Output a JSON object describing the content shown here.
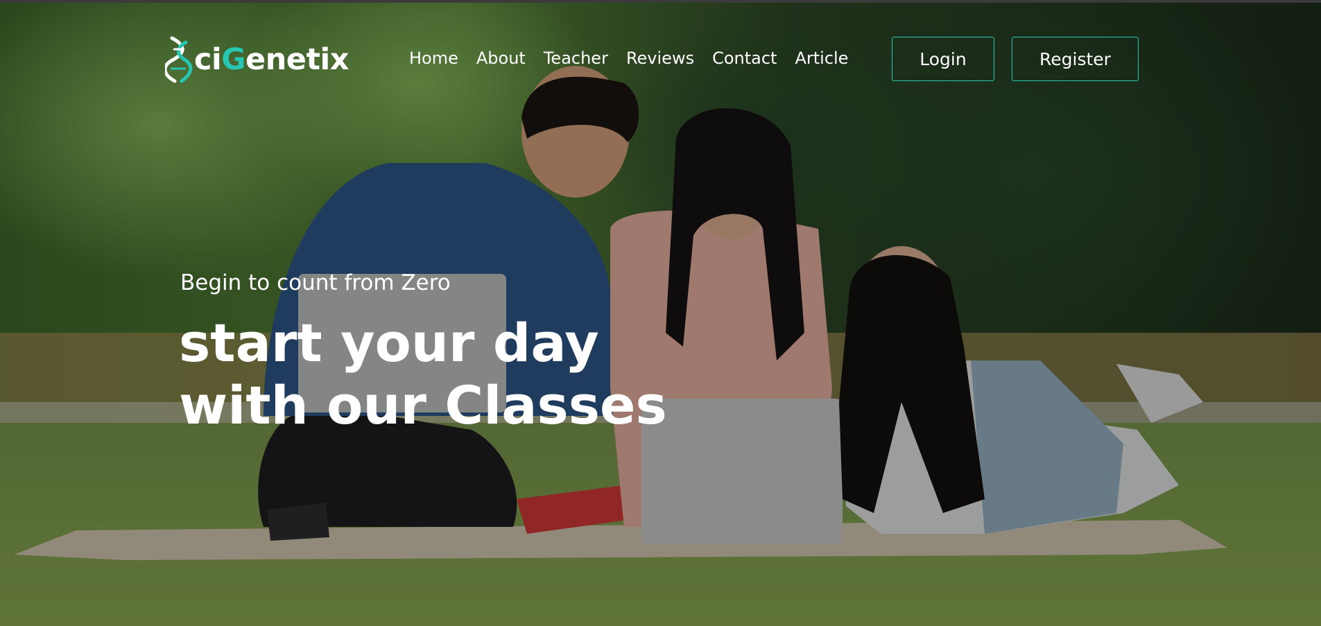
{
  "brand": {
    "logo_prefix": "ci",
    "logo_accent": "G",
    "logo_suffix": "enetix",
    "logo_initial": "S",
    "accent_color": "#26c6b3"
  },
  "nav": {
    "items": [
      {
        "label": "Home"
      },
      {
        "label": "About"
      },
      {
        "label": "Teacher"
      },
      {
        "label": "Reviews"
      },
      {
        "label": "Contact"
      },
      {
        "label": "Article"
      }
    ],
    "login_label": "Login",
    "register_label": "Register"
  },
  "hero": {
    "tagline": "Begin to count from Zero",
    "headline_line1": "start your day",
    "headline_line2": "with our Classes",
    "background_image": "students-with-laptops-on-grass"
  }
}
